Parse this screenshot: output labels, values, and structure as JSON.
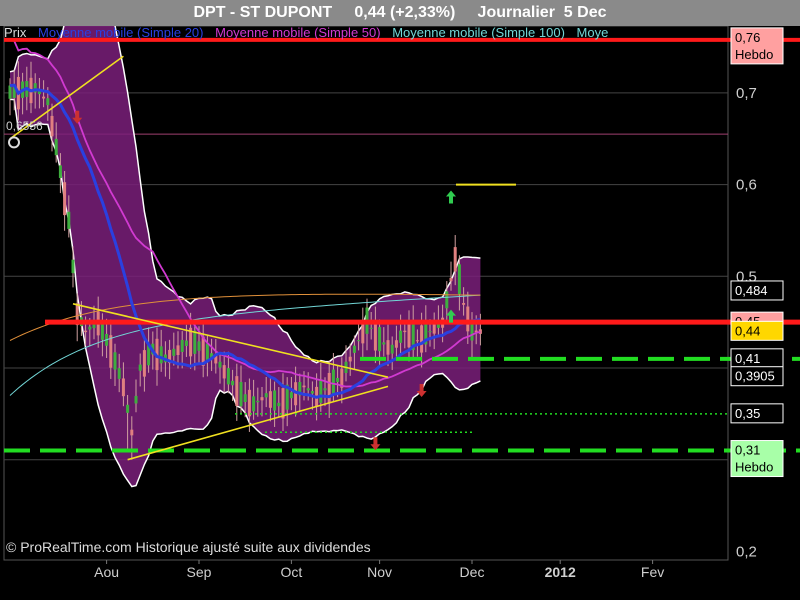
{
  "chart_data": {
    "type": "line",
    "title": "DPT - ST DUPONT     0,44 (+2,33%)     Journalier  5 Dec",
    "xlabel": "",
    "ylabel": "",
    "x_ticks": [
      "Aou",
      "Sep",
      "Oct",
      "Nov",
      "Dec",
      "2012",
      "Fev"
    ],
    "y_ticks": [
      "0,7",
      "0,6",
      "0,5",
      "0,2"
    ],
    "ylim": [
      0.2,
      0.76
    ],
    "grid": true,
    "legend": [
      "Prix",
      "Moyenne mobile (Simple 20)",
      "Moyenne mobile (Simple 50)",
      "Moyenne mobile (Simple 100)",
      "Moye"
    ],
    "annotation": "0,6556",
    "colors": {
      "ma20": "#2a40e0",
      "ma50": "#d13ad1",
      "ma100": "#72d6d6",
      "band": "#7a1f7a",
      "resistance": "#ff1a1a",
      "support": "#22dd22",
      "trend": "#f0e020",
      "up": "#30cc50",
      "down": "#cc3030"
    },
    "price_labels": [
      {
        "text": "0,76\nHebdo",
        "bg": "#ffa0a0",
        "fg": "#000",
        "value": 0.76
      },
      {
        "text": "0,484",
        "bg": "#000",
        "fg": "#fff",
        "value": 0.484
      },
      {
        "text": "0,45",
        "bg": "#ffa0a0",
        "fg": "#000",
        "value": 0.45
      },
      {
        "text": "0,44",
        "bg": "#ffd700",
        "fg": "#000",
        "value": 0.44
      },
      {
        "text": "0,41",
        "bg": "#000",
        "fg": "#fff",
        "value": 0.41
      },
      {
        "text": "0,3905",
        "bg": "#000",
        "fg": "#fff",
        "value": 0.3905
      },
      {
        "text": "0,35",
        "bg": "#000",
        "fg": "#fff",
        "value": 0.35
      },
      {
        "text": "0,31\nHebdo",
        "bg": "#a8ffa8",
        "fg": "#000",
        "value": 0.31
      }
    ],
    "levels": {
      "resistance": 0.45,
      "weekly_resistance": 0.76,
      "support": 0.41,
      "weekly_support": 0.31,
      "dotted_1": 0.35,
      "dotted_2": 0.33
    },
    "trendlines": [
      {
        "from": [
          0,
          0.65
        ],
        "to": [
          27,
          0.74
        ]
      },
      {
        "from": [
          15,
          0.47
        ],
        "to": [
          90,
          0.39
        ]
      },
      {
        "from": [
          28,
          0.3
        ],
        "to": [
          90,
          0.38
        ]
      }
    ],
    "signals": [
      {
        "day": 16,
        "type": "down",
        "value": 0.674
      },
      {
        "day": 105,
        "type": "up",
        "value": 0.586
      },
      {
        "day": 105,
        "type": "up",
        "value": 0.456
      },
      {
        "day": 98,
        "type": "down",
        "value": 0.376
      },
      {
        "day": 87,
        "type": "down",
        "value": 0.318
      }
    ],
    "last_value": 0.44,
    "change": "+2,33%"
  },
  "texts": {
    "copyright": "© ProRealTime.com Historique ajusté suite aux dividendes"
  }
}
